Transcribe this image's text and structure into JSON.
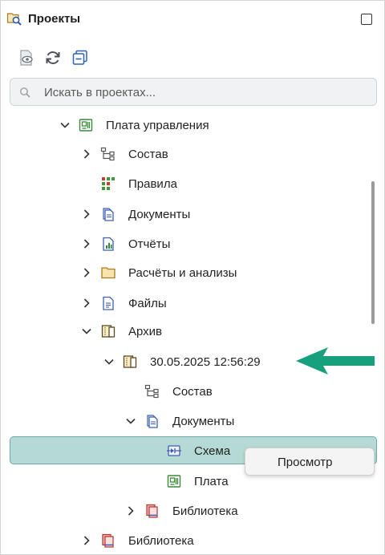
{
  "panel": {
    "title": "Проекты",
    "title_icon": "projects-folder-search-icon",
    "maximize_icon": "maximize-icon"
  },
  "toolbar": {
    "buttons": [
      {
        "icon": "view-document-icon"
      },
      {
        "icon": "refresh-icon"
      },
      {
        "icon": "collapse-all-icon"
      }
    ]
  },
  "search": {
    "placeholder": "Искать в проектах..."
  },
  "tree": {
    "items": [
      {
        "label": "Плата управления",
        "icon": "board-icon",
        "expanded": true
      },
      {
        "label": "Состав",
        "icon": "structure-icon",
        "expanded": false
      },
      {
        "label": "Правила",
        "icon": "rules-icon"
      },
      {
        "label": "Документы",
        "icon": "documents-icon",
        "expanded": false
      },
      {
        "label": "Отчёты",
        "icon": "report-icon",
        "expanded": false
      },
      {
        "label": "Расчёты и анализы",
        "icon": "folder-icon",
        "expanded": false
      },
      {
        "label": "Файлы",
        "icon": "file-icon",
        "expanded": false
      },
      {
        "label": "Архив",
        "icon": "archive-icon",
        "expanded": true
      },
      {
        "label": "30.05.2025 12:56:29",
        "icon": "archive-icon",
        "expanded": true
      },
      {
        "label": "Состав",
        "icon": "structure-icon"
      },
      {
        "label": "Документы",
        "icon": "documents-icon",
        "expanded": true
      },
      {
        "label": "Схема",
        "icon": "schematic-icon",
        "selected": true
      },
      {
        "label": "Плата",
        "icon": "board-icon"
      },
      {
        "label": "Библиотека",
        "icon": "library-icon",
        "expanded": false
      },
      {
        "label": "Библиотека",
        "icon": "library-icon",
        "expanded": false
      }
    ]
  },
  "context_menu": {
    "items": [
      {
        "label": "Просмотр"
      }
    ]
  },
  "colors": {
    "selection": "#b5dad5",
    "selection_border": "#6fa9a1",
    "arrow": "#17a07e",
    "board_icon": "#3a8a3a",
    "doc_icon": "#3d5fb5",
    "folder_icon": "#c49a3a"
  }
}
